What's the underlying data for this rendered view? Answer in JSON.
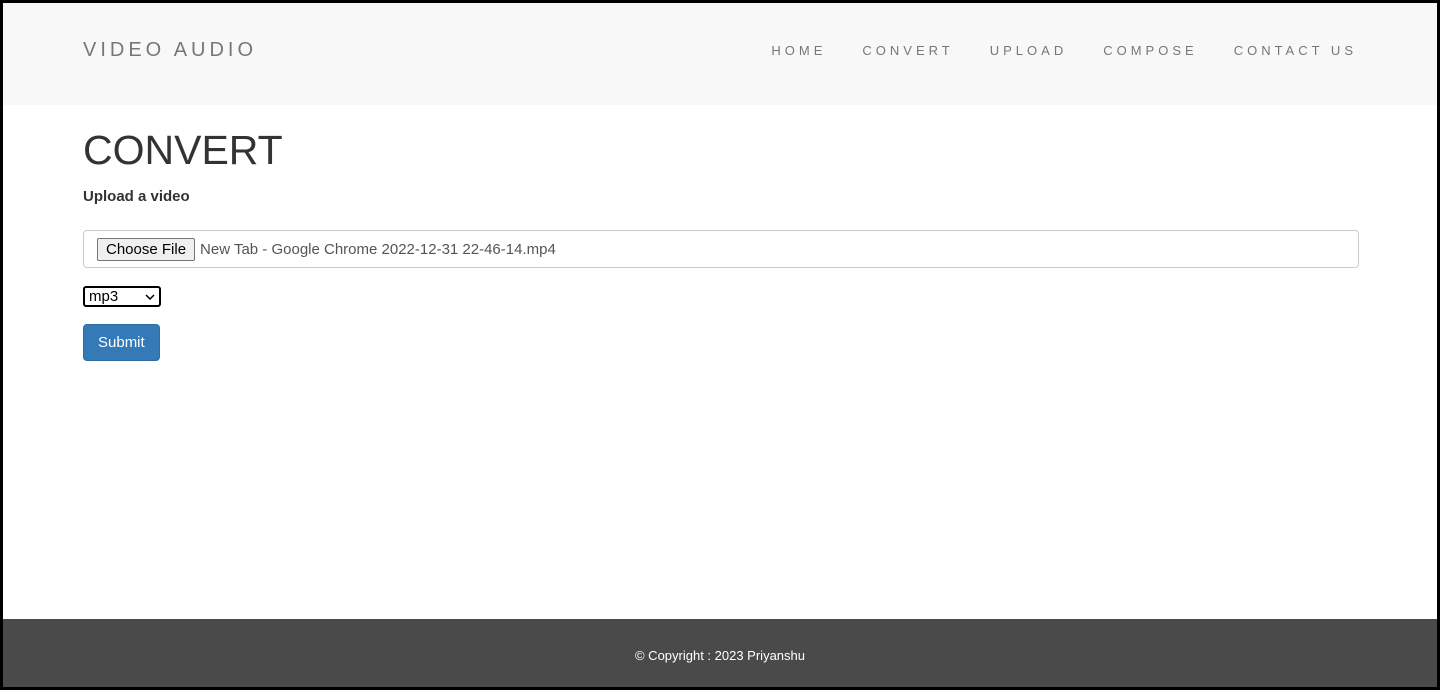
{
  "nav": {
    "brand": "VIDEO AUDIO",
    "items": [
      "HOME",
      "CONVERT",
      "UPLOAD",
      "COMPOSE",
      "CONTACT US"
    ]
  },
  "main": {
    "title": "CONVERT",
    "label": "Upload a video",
    "choose_file": "Choose File",
    "file_name": "New Tab - Google Chrome 2022-12-31 22-46-14.mp4",
    "format": "mp3",
    "submit": "Submit"
  },
  "footer": {
    "text": "© Copyright : 2023 Priyanshu"
  },
  "colors": {
    "accent": "#337ab7",
    "footer": "#4a4a4a"
  }
}
